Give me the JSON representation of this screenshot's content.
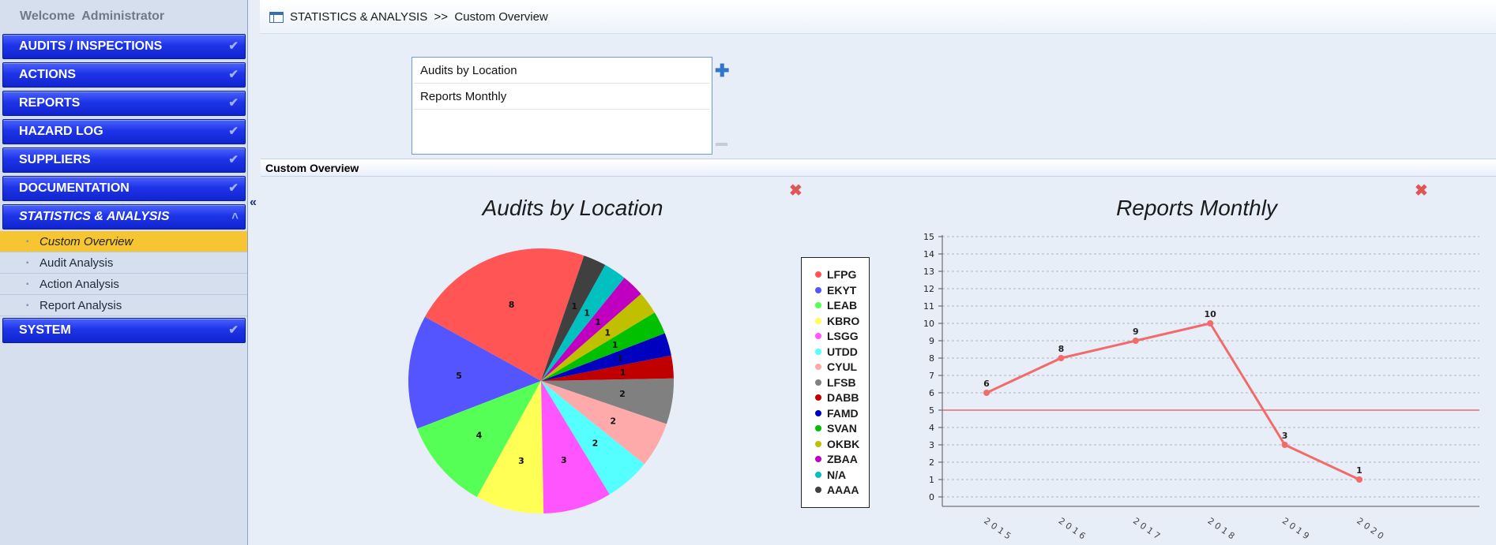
{
  "sidebar": {
    "welcome": "Welcome  Administrator",
    "nav": [
      {
        "label": "AUDITS / INSPECTIONS"
      },
      {
        "label": "ACTIONS"
      },
      {
        "label": "REPORTS"
      },
      {
        "label": "HAZARD LOG"
      },
      {
        "label": "SUPPLIERS"
      },
      {
        "label": "DOCUMENTATION"
      },
      {
        "label": "STATISTICS & ANALYSIS"
      }
    ],
    "subitems": [
      {
        "label": "Custom Overview"
      },
      {
        "label": "Audit Analysis"
      },
      {
        "label": "Action Analysis"
      },
      {
        "label": "Report Analysis"
      }
    ],
    "system": "SYSTEM",
    "collapse_icon": "«"
  },
  "breadcrumb": "STATISTICS & ANALYSIS  >>  Custom Overview",
  "overview_list": [
    "Audits by Location",
    "Reports Monthly"
  ],
  "add_icon": "✚",
  "panel_title": "Custom Overview",
  "close_icon": "✖",
  "colors": {
    "LFPG": "#ff5555",
    "EKYT": "#5555ff",
    "LEAB": "#55ff55",
    "KBRO": "#ffff55",
    "LSGG": "#ff55ff",
    "UTDD": "#55ffff",
    "CYUL": "#ffaaaa",
    "LFSB": "#808080",
    "DABB": "#c00000",
    "FAMD": "#0000c0",
    "SVAN": "#00c000",
    "OKBK": "#c0c000",
    "ZBAA": "#c000c0",
    "N/A": "#00c0c0",
    "AAAA": "#404040",
    "line": "#f26b6b",
    "refline": "#e05555"
  },
  "chart_data": [
    {
      "type": "pie",
      "title": "Audits by Location",
      "categories": [
        "LFPG",
        "EKYT",
        "LEAB",
        "KBRO",
        "LSGG",
        "UTDD",
        "CYUL",
        "LFSB",
        "DABB",
        "FAMD",
        "SVAN",
        "OKBK",
        "ZBAA",
        "N/A",
        "AAAA"
      ],
      "values": [
        8,
        5,
        4,
        3,
        3,
        2,
        2,
        2,
        1,
        1,
        1,
        1,
        1,
        1,
        1
      ],
      "legend": "right"
    },
    {
      "type": "line",
      "title": "Reports Monthly",
      "x": [
        "2015",
        "2016",
        "2017",
        "2018",
        "2019",
        "2020"
      ],
      "series": [
        {
          "values": [
            6,
            8,
            9,
            10,
            3,
            1
          ]
        }
      ],
      "ylim": [
        0,
        15
      ],
      "yticks": [
        0,
        1,
        2,
        3,
        4,
        5,
        6,
        7,
        8,
        9,
        10,
        11,
        12,
        13,
        14,
        15
      ],
      "reference_line": 5,
      "grid": true
    }
  ]
}
